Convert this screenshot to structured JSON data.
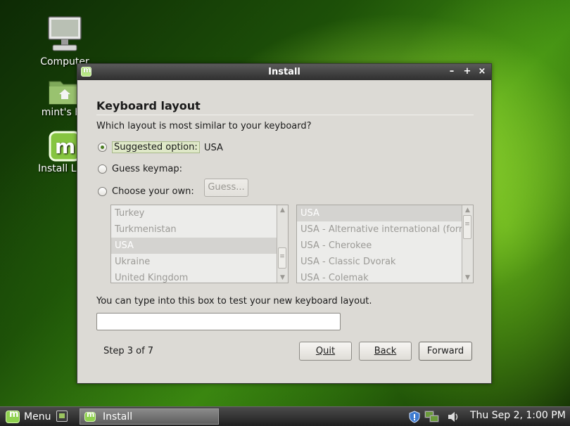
{
  "desktop": {
    "icons": [
      {
        "label": "Computer",
        "icon": "computer-icon"
      },
      {
        "label": "mint's Ho",
        "icon": "home-folder-icon"
      },
      {
        "label": "Install Linu",
        "icon": "mint-install-icon"
      }
    ]
  },
  "window": {
    "title": "Install",
    "controls": {
      "minimize": "–",
      "maximize": "+",
      "close": "×"
    }
  },
  "page": {
    "heading": "Keyboard layout",
    "question": "Which layout is most similar to your keyboard?",
    "options": {
      "suggested_label": "Suggested option:",
      "suggested_value": "USA",
      "guess_label": "Guess keymap:",
      "guess_button": "Guess...",
      "choose_label": "Choose your own:"
    },
    "selected_option": "suggested",
    "countries": [
      "Turkey",
      "Turkmenistan",
      "USA",
      "Ukraine",
      "United Kingdom"
    ],
    "selected_country": "USA",
    "variants": [
      "USA",
      "USA - Alternative international (forr",
      "USA - Cherokee",
      "USA - Classic Dvorak",
      "USA - Colemak"
    ],
    "selected_variant": "USA",
    "test_label": "You can type into this box to test your new keyboard layout.",
    "test_value": "",
    "step": "Step 3 of 7",
    "buttons": {
      "quit": "Quit",
      "back": "Back",
      "forward": "Forward"
    }
  },
  "taskbar": {
    "menu_label": "Menu",
    "task_label": "Install",
    "clock": "Thu Sep  2,  1:00 PM",
    "tray_icons": [
      "shield-icon",
      "network-icon",
      "volume-icon"
    ]
  },
  "colors": {
    "accent": "#4a7d22",
    "window_bg": "#dcdad5",
    "titlebar": "#3a3a3a"
  }
}
